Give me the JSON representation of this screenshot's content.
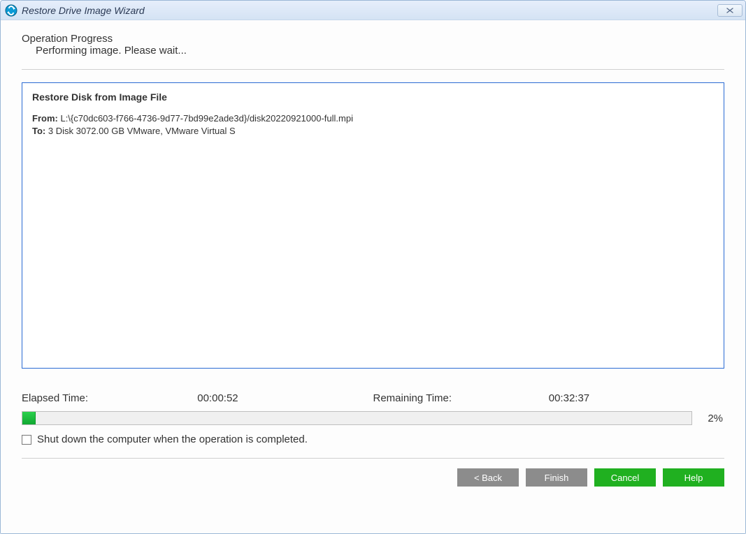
{
  "window": {
    "title": "Restore Drive Image Wizard"
  },
  "heading": {
    "title": "Operation Progress",
    "subtitle": "Performing image. Please wait..."
  },
  "panel": {
    "title": "Restore Disk from Image File",
    "from_label": "From:",
    "from_value": "L:\\{c70dc603-f766-4736-9d77-7bd99e2ade3d}/disk20220921000-full.mpi",
    "to_label": "To:",
    "to_value": "3 Disk 3072.00 GB VMware, VMware Virtual S"
  },
  "progress": {
    "elapsed_label": "Elapsed Time:",
    "elapsed_value": "00:00:52",
    "remaining_label": "Remaining Time:",
    "remaining_value": "00:32:37",
    "percent_text": "2%",
    "percent_value": 2
  },
  "shutdown": {
    "checked": false,
    "label": "Shut down the computer when the operation is completed."
  },
  "buttons": {
    "back": "< Back",
    "finish": "Finish",
    "cancel": "Cancel",
    "help": "Help"
  }
}
